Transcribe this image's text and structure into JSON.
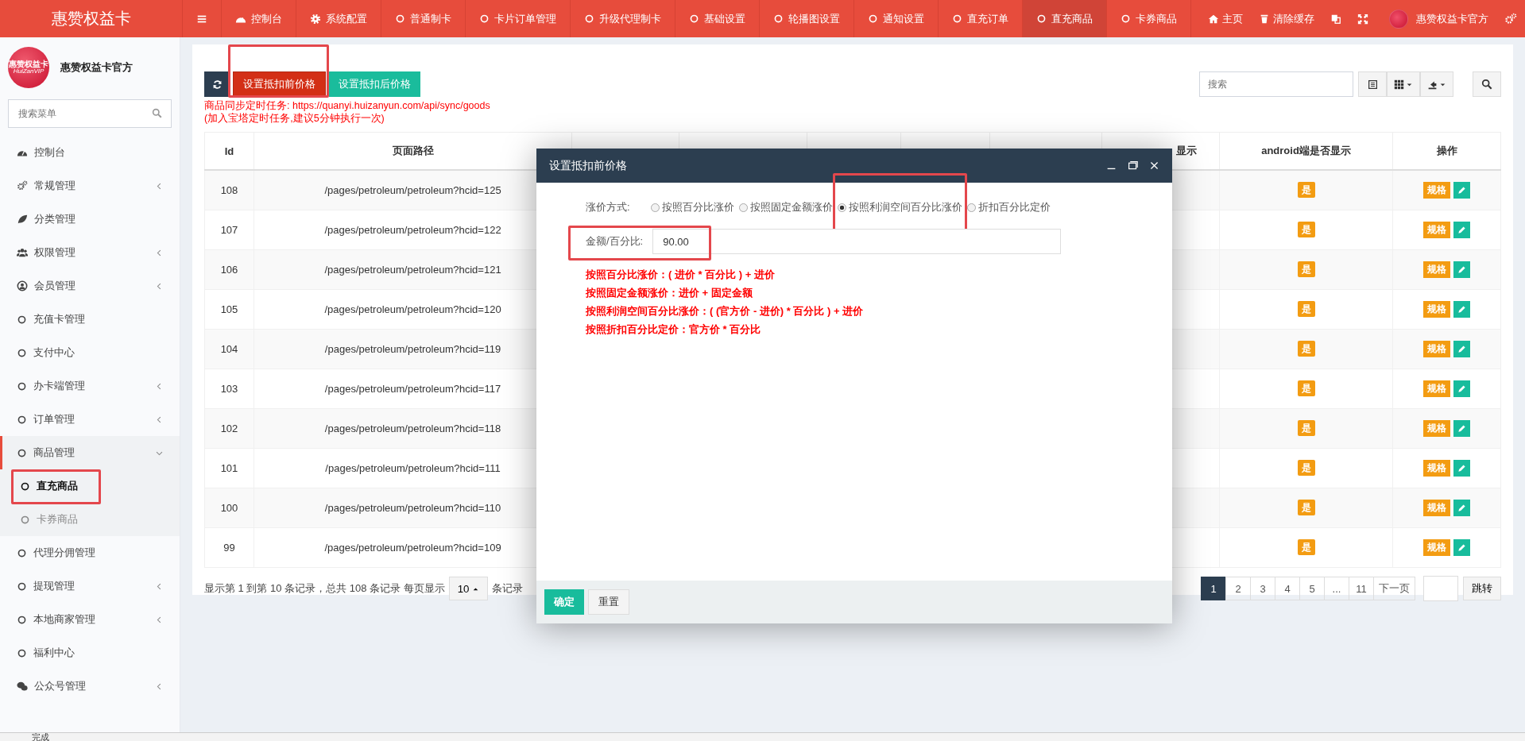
{
  "topbar": {
    "brand": "惠赞权益卡",
    "nav": [
      {
        "kind": "dashboard",
        "label": "控制台",
        "selected": false
      },
      {
        "kind": "gear",
        "label": "系统配置",
        "selected": false
      },
      {
        "kind": "circle",
        "label": "普通制卡",
        "selected": false
      },
      {
        "kind": "circle",
        "label": "卡片订单管理",
        "selected": false
      },
      {
        "kind": "circle",
        "label": "升级代理制卡",
        "selected": false
      },
      {
        "kind": "circle",
        "label": "基础设置",
        "selected": false
      },
      {
        "kind": "circle",
        "label": "轮播图设置",
        "selected": false
      },
      {
        "kind": "circle",
        "label": "通知设置",
        "selected": false
      },
      {
        "kind": "circle",
        "label": "直充订单",
        "selected": false
      },
      {
        "kind": "circle",
        "label": "直充商品",
        "selected": true
      },
      {
        "kind": "circle",
        "label": "卡券商品",
        "selected": false
      }
    ],
    "tools": [
      {
        "kind": "home",
        "label": "主页"
      },
      {
        "kind": "trash",
        "label": "清除缓存"
      }
    ],
    "user": "惠赞权益卡官方"
  },
  "sidebar": {
    "logo_text": [
      "惠赞权益卡",
      "HuiZanVIP"
    ],
    "name": "惠赞权益卡官方",
    "search": {
      "placeholder": "搜索菜单"
    },
    "items": [
      {
        "kind": "dashboard",
        "label": "控制台",
        "expandable": false,
        "selected": false
      },
      {
        "kind": "cogs",
        "label": "常规管理",
        "expandable": true,
        "expanded": false,
        "selected": false
      },
      {
        "kind": "leaf",
        "label": "分类管理",
        "expandable": false,
        "selected": false
      },
      {
        "kind": "users",
        "label": "权限管理",
        "expandable": true,
        "expanded": false,
        "selected": false
      },
      {
        "kind": "user",
        "label": "会员管理",
        "expandable": true,
        "expanded": false,
        "selected": false
      },
      {
        "kind": "circle",
        "label": "充值卡管理",
        "expandable": false,
        "selected": false
      },
      {
        "kind": "circle",
        "label": "支付中心",
        "expandable": false,
        "selected": false
      },
      {
        "kind": "circle",
        "label": "办卡端管理",
        "expandable": true,
        "expanded": false,
        "selected": false
      },
      {
        "kind": "circle",
        "label": "订单管理",
        "expandable": true,
        "expanded": false,
        "selected": false
      },
      {
        "kind": "circle",
        "label": "商品管理",
        "expandable": true,
        "expanded": true,
        "selected": true,
        "children": [
          {
            "label": "直充商品",
            "selected": true,
            "annotated": true
          },
          {
            "label": "卡券商品",
            "selected": false,
            "annotated": false
          }
        ]
      },
      {
        "kind": "circle",
        "label": "代理分佣管理",
        "expandable": false,
        "selected": false
      },
      {
        "kind": "circle",
        "label": "提现管理",
        "expandable": true,
        "expanded": false,
        "selected": false
      },
      {
        "kind": "circle",
        "label": "本地商家管理",
        "expandable": true,
        "expanded": false,
        "selected": false
      },
      {
        "kind": "circle",
        "label": "福利中心",
        "expandable": false,
        "selected": false
      },
      {
        "kind": "wechat",
        "label": "公众号管理",
        "expandable": true,
        "expanded": false,
        "selected": false
      }
    ]
  },
  "toolbar": {
    "buttons": [
      {
        "kind": "refresh",
        "annotated": false
      },
      {
        "kind": "danger",
        "label": "设置抵扣前价格",
        "annotated": true
      },
      {
        "kind": "success",
        "label": "设置抵扣后价格",
        "annotated": false
      }
    ],
    "notes": [
      "商品同步定时任务: https://quanyi.huizanyun.com/api/sync/goods",
      "(加入宝塔定时任务,建议5分钟执行一次)"
    ],
    "search": {
      "placeholder": "搜索"
    }
  },
  "table": {
    "columns": [
      "Id",
      "页面路径",
      "显示",
      "android端是否显示",
      "操作"
    ],
    "rows": [
      {
        "id": "108",
        "path": "/pages/petroleum/petroleum?hcid=125",
        "android": "是",
        "spec": "规格"
      },
      {
        "id": "107",
        "path": "/pages/petroleum/petroleum?hcid=122",
        "android": "是",
        "spec": "规格"
      },
      {
        "id": "106",
        "path": "/pages/petroleum/petroleum?hcid=121",
        "android": "是",
        "spec": "规格"
      },
      {
        "id": "105",
        "path": "/pages/petroleum/petroleum?hcid=120",
        "android": "是",
        "spec": "规格"
      },
      {
        "id": "104",
        "path": "/pages/petroleum/petroleum?hcid=119",
        "android": "是",
        "spec": "规格"
      },
      {
        "id": "103",
        "path": "/pages/petroleum/petroleum?hcid=117",
        "android": "是",
        "spec": "规格"
      },
      {
        "id": "102",
        "path": "/pages/petroleum/petroleum?hcid=118",
        "android": "是",
        "spec": "规格"
      },
      {
        "id": "101",
        "path": "/pages/petroleum/petroleum?hcid=111",
        "android": "是",
        "spec": "规格"
      },
      {
        "id": "100",
        "path": "/pages/petroleum/petroleum?hcid=110",
        "android": "是",
        "spec": "规格"
      },
      {
        "id": "99",
        "path": "/pages/petroleum/petroleum?hcid=109",
        "android": "是",
        "spec": "规格"
      }
    ]
  },
  "pagination": {
    "summary": "显示第 1 到第 10 条记录，总共 108 条记录 每页显示",
    "page_size": "10",
    "suffix": "条记录",
    "pages": [
      {
        "label": "1",
        "selected": true
      },
      {
        "label": "2",
        "selected": false
      },
      {
        "label": "3",
        "selected": false
      },
      {
        "label": "4",
        "selected": false
      },
      {
        "label": "5",
        "selected": false
      },
      {
        "label": "...",
        "selected": false
      },
      {
        "label": "11",
        "selected": false
      },
      {
        "label": "下一页",
        "selected": false
      }
    ],
    "jump": "跳转"
  },
  "modal": {
    "title": "设置抵扣前价格",
    "method_label": "涨价方式:",
    "options": [
      {
        "label": "按照百分比涨价",
        "selected": false,
        "annotated": false
      },
      {
        "label": "按照固定金额涨价",
        "selected": false,
        "annotated": false
      },
      {
        "label": "按照利润空间百分比涨价",
        "selected": true,
        "annotated": true
      },
      {
        "label": "折扣百分比定价",
        "selected": false,
        "annotated": false
      }
    ],
    "amount": {
      "label": "金额/百分比:",
      "value": "90.00",
      "annotated": true
    },
    "formulas": [
      "按照百分比涨价：( 进价 * 百分比 ) + 进价",
      "按照固定金额涨价：进价 + 固定金额",
      "按照利润空间百分比涨价：( (官方价 - 进价) * 百分比 ) + 进价",
      "按照折扣百分比定价：官方价 * 百分比"
    ],
    "buttons": [
      {
        "kind": "primary",
        "label": "确定"
      },
      {
        "kind": "default",
        "label": "重置"
      }
    ]
  },
  "status_bar": {
    "text": "完成"
  }
}
